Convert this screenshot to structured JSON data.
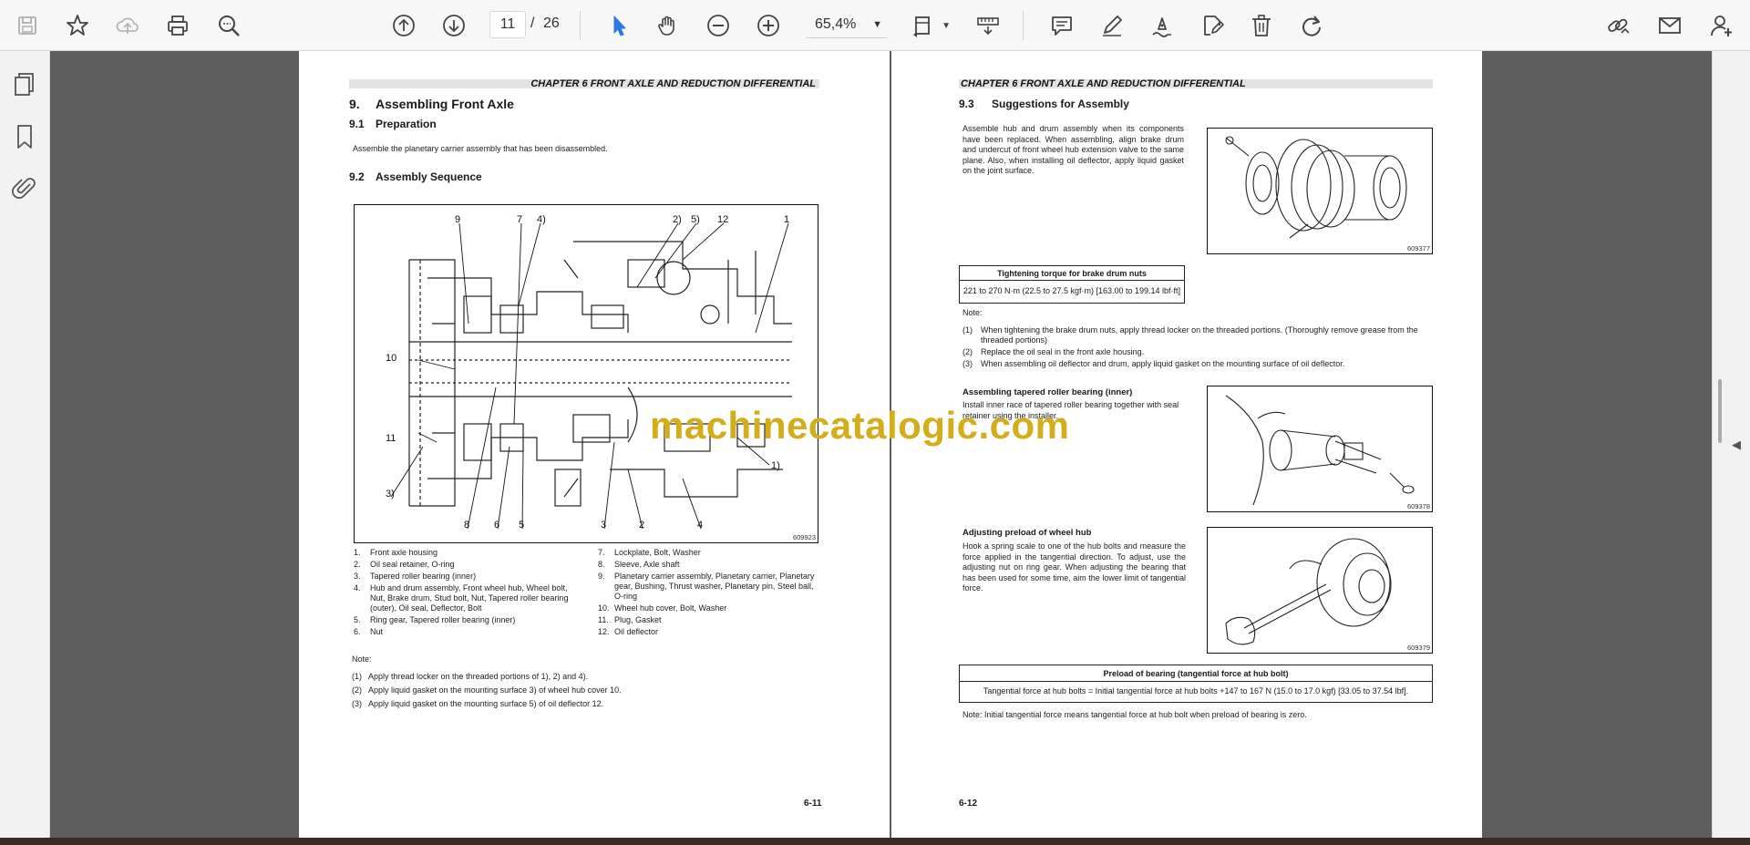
{
  "toolbar": {
    "page_current": "11",
    "page_separator": "/",
    "page_total": "26",
    "zoom": "65,4%"
  },
  "left_page": {
    "chapter": "CHAPTER 6 FRONT AXLE AND REDUCTION DIFFERENTIAL",
    "section_num": "9.",
    "section_title": "Assembling Front Axle",
    "sub1_num": "9.1",
    "sub1_title": "Preparation",
    "prep_text": "Assemble the planetary carrier assembly that has been disassembled.",
    "sub2_num": "9.2",
    "sub2_title": "Assembly Sequence",
    "fig_code": "609923",
    "callouts": [
      "9",
      "7",
      "4)",
      "2)",
      "5)",
      "12",
      "1",
      "10",
      "11",
      "3)",
      "1)",
      "8",
      "6",
      "5",
      "3",
      "2",
      "4"
    ],
    "parts": [
      {
        "num": "1.",
        "text": "Front axle housing"
      },
      {
        "num": "2.",
        "text": "Oil seal retainer, O-ring"
      },
      {
        "num": "3.",
        "text": "Tapered roller bearing (inner)"
      },
      {
        "num": "4.",
        "text": "Hub and drum assembly, Front wheel hub, Wheel bolt, Nut, Brake drum, Stud bolt, Nut, Tapered roller bearing (outer), Oil seal, Deflector, Bolt"
      },
      {
        "num": "5.",
        "text": "Ring gear, Tapered roller bearing (inner)"
      },
      {
        "num": "6.",
        "text": "Nut"
      },
      {
        "num": "7.",
        "text": "Lockplate, Bolt, Washer"
      },
      {
        "num": "8.",
        "text": "Sleeve, Axle shaft"
      },
      {
        "num": "9.",
        "text": "Planetary carrier assembly, Planetary carrier, Planetary gear, Bushing, Thrust washer, Planetary pin, Steel ball, O-ring"
      },
      {
        "num": "10.",
        "text": "Wheel hub cover, Bolt, Washer"
      },
      {
        "num": "11.",
        "text": "Plug, Gasket"
      },
      {
        "num": "12.",
        "text": "Oil deflector"
      }
    ],
    "note_label": "Note:",
    "notes": [
      {
        "num": "(1)",
        "text": "Apply thread locker on the threaded portions of 1), 2) and 4)."
      },
      {
        "num": "(2)",
        "text": "Apply liquid gasket on the mounting surface 3) of wheel hub cover 10."
      },
      {
        "num": "(3)",
        "text": "Apply liquid gasket on the mounting surface 5) of oil deflector 12."
      }
    ],
    "page_number": "6-11"
  },
  "right_page": {
    "chapter": "CHAPTER 6 FRONT AXLE AND REDUCTION DIFFERENTIAL",
    "sub_num": "9.3",
    "sub_title": "Suggestions for Assembly",
    "intro_text": "Assemble hub and drum assembly when its components have been replaced. When assembling, align brake drum and undercut of front wheel hub extension valve to the same plane. Also, when installing oil deflector, apply liquid gasket on the joint surface.",
    "fig1_code": "609377",
    "torque_table_title": "Tightening torque for brake drum nuts",
    "torque_table_value": "221 to 270 N·m (22.5 to 27.5 kgf·m) [163.00 to 199.14 lbf·ft]",
    "note_label": "Note:",
    "notes": [
      {
        "num": "(1)",
        "text": "When tightening the brake drum nuts, apply thread locker on the threaded portions. (Thoroughly remove grease from the threaded portions)"
      },
      {
        "num": "(2)",
        "text": "Replace the oil seal in the front axle housing."
      },
      {
        "num": "(3)",
        "text": "When assembling oil deflector and drum, apply liquid gasket on the mounting surface of oil deflector."
      }
    ],
    "bearing_title": "Assembling tapered roller bearing (inner)",
    "bearing_text": "Install inner race of tapered roller bearing together with seal retainer using the installer.",
    "fig2_code": "609378",
    "preload_title": "Adjusting preload of wheel hub",
    "preload_text": "Hook a spring scale to one of the hub bolts and measure the force applied in the tangential direction. To adjust, use the adjusting nut on ring gear. When adjusting the bearing that has been used for some time, aim the lower limit of tangential force.",
    "fig3_code": "609379",
    "preload_table_title": "Preload of bearing (tangential force at hub bolt)",
    "preload_table_value": "Tangential force at hub bolts = Initial tangential force at hub bolts +147 to 167 N (15.0 to 17.0 kgf) [33.05 to 37.54 lbf].",
    "final_note": "Note: Initial tangential force means tangential force at hub bolt when preload of bearing is zero.",
    "page_number": "6-12"
  },
  "watermark": "machinecatalogic.com",
  "icons": [
    "save-icon",
    "star-icon",
    "cloud-upload-icon",
    "print-icon",
    "zoom-search-icon",
    "page-up-icon",
    "page-down-icon",
    "select-arrow-icon",
    "hand-icon",
    "zoom-out-icon",
    "zoom-in-icon",
    "page-fit-icon",
    "measure-icon",
    "comment-icon",
    "pencil-icon",
    "sign-icon",
    "edit-icon",
    "trash-icon",
    "redo-icon",
    "share-link-icon",
    "mail-icon",
    "add-user-icon",
    "pages-icon",
    "bookmark-icon",
    "attachment-icon"
  ]
}
